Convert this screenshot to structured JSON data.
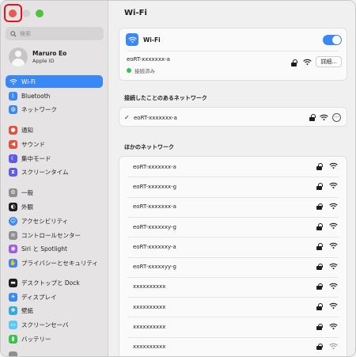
{
  "search": {
    "placeholder": "検索"
  },
  "user": {
    "name": "Maruro Eo",
    "subtitle": "Apple ID"
  },
  "sidebar": {
    "items": [
      {
        "label": "Wi-Fi",
        "icon": "wifi-icon",
        "color": "#3a87f6",
        "selected": true
      },
      {
        "label": "Bluetooth",
        "icon": "bluetooth-icon",
        "color": "#3a87f6"
      },
      {
        "label": "ネットワーク",
        "icon": "globe-icon",
        "color": "#3a87f6"
      },
      {
        "label": "通知",
        "icon": "bell-icon",
        "color": "#eb4d3d"
      },
      {
        "label": "サウンド",
        "icon": "speaker-icon",
        "color": "#eb4d3d"
      },
      {
        "label": "集中モード",
        "icon": "moon-icon",
        "color": "#5e5ce6"
      },
      {
        "label": "スクリーンタイム",
        "icon": "hourglass-icon",
        "color": "#5e5ce6"
      },
      {
        "label": "一般",
        "icon": "gear-icon",
        "color": "#8e8e93"
      },
      {
        "label": "外観",
        "icon": "appearance-icon",
        "color": "#1d1d1f"
      },
      {
        "label": "アクセシビリティ",
        "icon": "accessibility-icon",
        "color": "#3a87f6"
      },
      {
        "label": "コントロールセンター",
        "icon": "control-center-icon",
        "color": "#8e8e93"
      },
      {
        "label": "Siri と Spotlight",
        "icon": "siri-icon",
        "color": "#a05ce6"
      },
      {
        "label": "プライバシーとセキュリティ",
        "icon": "hand-icon",
        "color": "#3a87f6"
      },
      {
        "label": "デスクトップと Dock",
        "icon": "dock-icon",
        "color": "#1d1d1f"
      },
      {
        "label": "ディスプレイ",
        "icon": "display-icon",
        "color": "#3a87f6"
      },
      {
        "label": "壁紙",
        "icon": "wallpaper-icon",
        "color": "#34aadc"
      },
      {
        "label": "スクリーンセーバ",
        "icon": "screensaver-icon",
        "color": "#5ac8fa"
      },
      {
        "label": "バッテリー",
        "icon": "battery-icon",
        "color": "#39c24b"
      }
    ]
  },
  "main": {
    "title": "Wi-Fi",
    "wifi_label": "Wi-Fi",
    "wifi_enabled": true,
    "current_network": {
      "name": "eoRT-xxxxxxx-a",
      "status": "接続済み",
      "details_button": "詳細..."
    },
    "known_section_title": "接続したことのあるネットワーク",
    "known_network": {
      "check": "✓",
      "name": "eoRT-xxxxxxx-a"
    },
    "other_section_title": "ほかのネットワーク",
    "other_networks": [
      "eoRT-xxxxxxx-a",
      "eoRT-xxxxxxx-g",
      "eoRT-xxxxxxx-a",
      "eoRT-xxxxxxy-g",
      "eoRT-xxxxxxy-a",
      "eoRT-xxxxxyy-g",
      "xxxxxxxxxx",
      "xxxxxxxxxx",
      "xxxxxxxxxx",
      "xxxxxxxxxx"
    ]
  }
}
